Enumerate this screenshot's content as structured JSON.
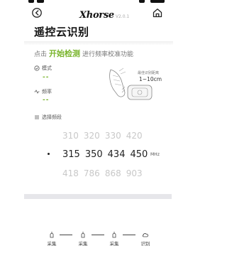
{
  "header": {
    "brand": "Xhorse",
    "version": "V2.0.1"
  },
  "page": {
    "title": "遥控云识别"
  },
  "instruction": {
    "prefix": "点击",
    "action": "开始检测",
    "suffix": "进行频率校准功能"
  },
  "fields": {
    "mode_label": "模式",
    "mode_value": "--",
    "freq_label": "频率",
    "freq_value": "--",
    "select_label": "选择频段"
  },
  "range_hint": {
    "label": "最佳识别距离",
    "value": "1~10cm"
  },
  "frequencies": {
    "above": [
      "310",
      "320",
      "330",
      "420"
    ],
    "selected": [
      "315",
      "350",
      "434",
      "450"
    ],
    "below": [
      "418",
      "786",
      "868",
      "903"
    ],
    "unit": "MHz"
  },
  "steps": [
    {
      "label": "采集",
      "icon": "remote-key-icon"
    },
    {
      "label": "采集",
      "icon": "remote-key-icon"
    },
    {
      "label": "采集",
      "icon": "remote-key-icon"
    },
    {
      "label": "识别",
      "icon": "cloud-icon"
    }
  ],
  "colors": {
    "accent": "#7ab52e",
    "muted_frequency": "#c8c8c8",
    "divider": "#e6e6ea"
  }
}
